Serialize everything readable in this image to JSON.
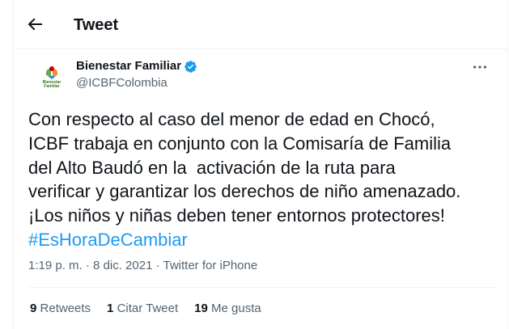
{
  "header": {
    "title": "Tweet"
  },
  "tweet": {
    "author": {
      "name": "Bienestar Familiar",
      "handle": "@ICBFColombia",
      "logo_text_line1": "Bienestar",
      "logo_text_line2": "Familiar"
    },
    "text": "Con respecto al caso del menor de edad en Chocó,\nICBF trabaja en conjunto con la Comisaría de Familia\ndel Alto Baudó en la  activación de la ruta para\nverificar y garantizar los derechos de niño amenazado.\n¡Los niños y niñas deben tener entornos protectores!\n",
    "hashtag": "#EsHoraDeCambiar",
    "meta": "1:19 p. m. · 8 dic. 2021 · Twitter for iPhone"
  },
  "stats": {
    "retweets_count": "9",
    "retweets_label": "Retweets",
    "quotes_count": "1",
    "quotes_label": "Citar Tweet",
    "likes_count": "19",
    "likes_label": "Me gusta"
  },
  "colors": {
    "accent": "#1d9bf0",
    "secondary_text": "#536471",
    "primary_text": "#0f1419",
    "divider": "#eff3f4"
  },
  "icons": [
    "back-arrow-icon",
    "verified-badge-icon",
    "more-icon"
  ]
}
